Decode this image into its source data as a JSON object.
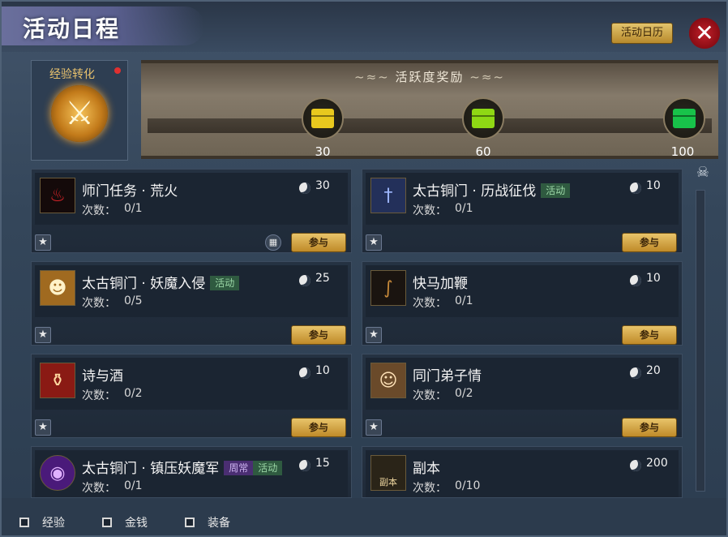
{
  "window": {
    "title": "活动日程",
    "calendar_button": "活动日历",
    "close_icon": "✕"
  },
  "experience": {
    "label": "经验转化",
    "icon": "swords-emblem"
  },
  "reward_panel": {
    "title": "活跃度奖励",
    "chests": [
      {
        "value": "30",
        "color": "#e8c81e"
      },
      {
        "value": "60",
        "color": "#8fd814"
      },
      {
        "value": "100",
        "color": "#18c24a"
      }
    ]
  },
  "activities": [
    {
      "name": "师门任务 · 荒火",
      "tags": [],
      "points": "30",
      "count_label": "次数：",
      "count": "0/1",
      "icon": "flame-icon",
      "icon_bg": "#140a0a",
      "join": "参与",
      "has_calendar": true
    },
    {
      "name": "太古铜门 · 历战征伐",
      "tags": [
        "活动"
      ],
      "points": "10",
      "count_label": "次数：",
      "count": "0/1",
      "icon": "sword-icon",
      "icon_bg": "#23305a",
      "join": "参与",
      "has_calendar": false
    },
    {
      "name": "太古铜门 · 妖魔入侵",
      "tags": [
        "活动"
      ],
      "points": "25",
      "count_label": "次数：",
      "count": "0/5",
      "icon": "demon-icon",
      "icon_bg": "#a06a20",
      "join": "参与",
      "has_calendar": false
    },
    {
      "name": "快马加鞭",
      "tags": [],
      "points": "10",
      "count_label": "次数：",
      "count": "0/1",
      "icon": "whip-icon",
      "icon_bg": "#1a1410",
      "join": "参与",
      "has_calendar": false
    },
    {
      "name": "诗与酒",
      "tags": [],
      "points": "10",
      "count_label": "次数：",
      "count": "0/2",
      "icon": "wine-jar-icon",
      "icon_bg": "#8a1a14",
      "join": "参与",
      "has_calendar": false
    },
    {
      "name": "同门弟子情",
      "tags": [],
      "points": "20",
      "count_label": "次数：",
      "count": "0/2",
      "icon": "couple-icon",
      "icon_bg": "#6a4a2a",
      "join": "参与",
      "has_calendar": false
    },
    {
      "name": "太古铜门 · 镇压妖魔军",
      "tags": [
        "周常",
        "活动"
      ],
      "points": "15",
      "count_label": "次数：",
      "count": "0/1",
      "icon": "purple-orb-icon",
      "icon_bg": "#4a1a7a",
      "join": "参与",
      "has_calendar": false
    },
    {
      "name": "副本",
      "tags": [],
      "points": "200",
      "count_label": "次数：",
      "count": "0/10",
      "icon": "dungeon-icon",
      "icon_bg": "#2a2418",
      "icon_text": "副本",
      "join": "参与",
      "has_calendar": false
    }
  ],
  "filters": [
    {
      "label": "经验"
    },
    {
      "label": "金钱"
    },
    {
      "label": "装备"
    }
  ]
}
